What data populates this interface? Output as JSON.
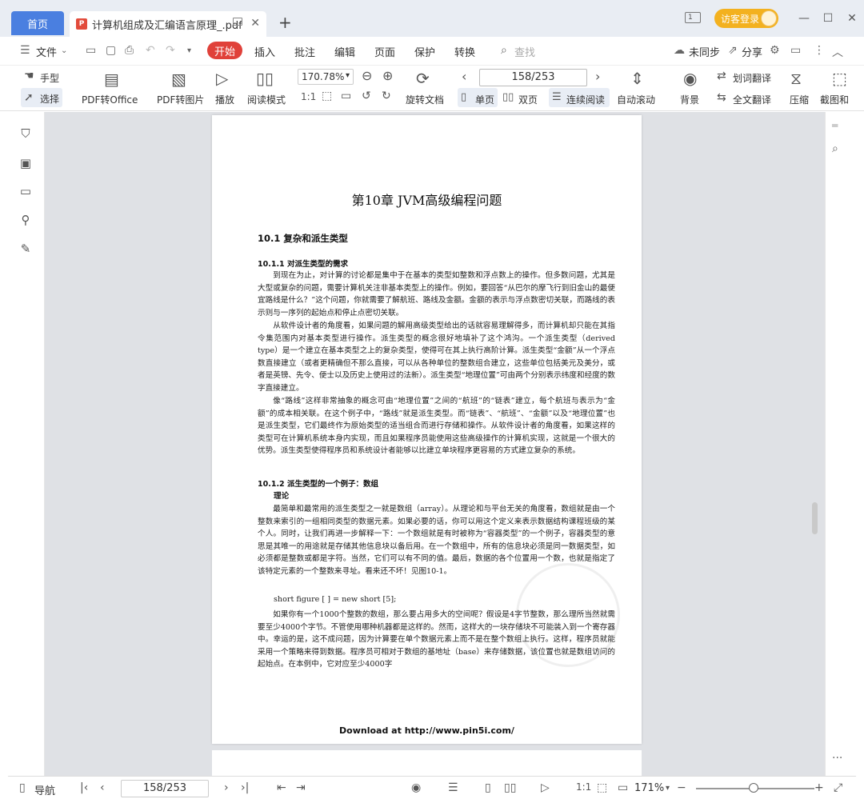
{
  "titlebar": {
    "home_tab": "首页",
    "doc_tab": "计算机组成及汇编语言原理_.pdf",
    "new_tab": "+",
    "guest_button": "访客登录",
    "layout_badge": "1"
  },
  "menubar": {
    "file": "文件",
    "items": [
      "开始",
      "插入",
      "批注",
      "编辑",
      "页面",
      "保护",
      "转换"
    ],
    "search": "查找",
    "sync": "未同步",
    "share": "分享"
  },
  "toolbar": {
    "hand": "手型",
    "select": "选择",
    "pdf_to_office": "PDF转Office",
    "pdf_to_image": "PDF转图片",
    "play": "播放",
    "read_mode": "阅读模式",
    "zoom": "170.78%",
    "page_indicator": "158/253",
    "rotate_doc": "旋转文档",
    "single_page": "单页",
    "double_page": "双页",
    "continuous": "连续阅读",
    "auto_scroll": "自动滚动",
    "background": "背景",
    "word_translate": "划词翻译",
    "full_translate": "全文翻译",
    "compress": "压缩",
    "screenshot": "截图和"
  },
  "document": {
    "chapter_title": "第10章 JVM高级编程问题",
    "section_10_1": "10.1  复杂和派生类型",
    "section_10_1_1": "10.1.1  对派生类型的需求",
    "para1": "到现在为止，对计算的讨论都是集中于在基本的类型如整数和浮点数上的操作。但多数问题，尤其是大型或复杂的问题，需要计算机关注非基本类型上的操作。例如，要回答“从巴尔的摩飞行到旧金山的最便宜路线是什么？”这个问题，你就需要了解航班、路线及金额。金额的表示与浮点数密切关联，而路线的表示则与一序列的起始点和停止点密切关联。",
    "para2": "从软件设计者的角度看，如果问题的解用高级类型给出的话就容易理解得多，而计算机却只能在其指令集范围内对基本类型进行操作。派生类型的概念很好地填补了这个鸿沟。一个派生类型（derived type）是一个建立在基本类型之上的复杂类型，使得可在其上执行高阶计算。派生类型“金额”从一个浮点数直接建立（或者更精确但不那么直接，可以从各种单位的整数组合建立，这些单位包括美元及美分，或者是英镑、先令、便士以及历史上使用过的法新）。派生类型“地理位置”可由两个分别表示纬度和经度的数字直接建立。",
    "para3": "像“路线”这样非常抽象的概念可由“地理位置”之间的“航班”的“链表”建立，每个航班与表示为“金额”的成本相关联。在这个例子中，“路线”就是派生类型。而“链表”、“航班”、“金额”以及“地理位置”也是派生类型，它们最终作为原始类型的适当组合而进行存储和操作。从软件设计者的角度看，如果这样的类型可在计算机系统本身内实现，而且如果程序员能使用这些高级操作的计算机实现，这就是一个很大的优势。派生类型使得程序员和系统设计者能够以比建立单块程序更容易的方式建立复杂的系统。",
    "section_10_1_2": "10.1.2  派生类型的一个例子：数组",
    "theory_label": "理论",
    "para4": "最简单和最常用的派生类型之一就是数组（array）。从理论和与平台无关的角度看，数组就是由一个整数来索引的一组相同类型的数据元素。如果必要的话，你可以用这个定义来表示数据结构课程班级的某个人。同时，让我们再进一步解释一下：一个数组就是有时被称为“容器类型”的一个例子，容器类型的意思是其唯一的用途就是存储其他信息块以备后用。在一个数组中，所有的信息块必须是同一数据类型，如必须都是整数或都是字符。当然，它们可以有不同的值。最后，数据的各个位置用一个数，也就是指定了该特定元素的一个整数来寻址。看来还不坏！见图10-1。",
    "code_line": "short figure [ ] = new short [5];",
    "para5": "如果你有一个1000个整数的数组，那么要占用多大的空间呢？假设是4字节整数，那么理所当然就需要至少4000个字节。不管使用哪种机器都是这样的。然而，这样大的一块存储块不可能装入到一个寄存器中。幸运的是，这不成问题，因为计算要在单个数据元素上而不是在整个数组上执行。这样，程序员就能采用一个策略来得到数据。程序员可相对于数组的基地址（base）来存储数据，该位置也就是数组访问的起始点。在本例中，它对应至少4000字",
    "footer": "Download at http://www.pin5i.com/"
  },
  "statusbar": {
    "nav": "导航",
    "page": "158/253",
    "zoom": "171%"
  },
  "colors": {
    "accent_blue": "#4a7fe0",
    "start_red": "#e0413a",
    "guest_orange": "#f3b11f",
    "workspace_gray": "#dfe1e5"
  }
}
